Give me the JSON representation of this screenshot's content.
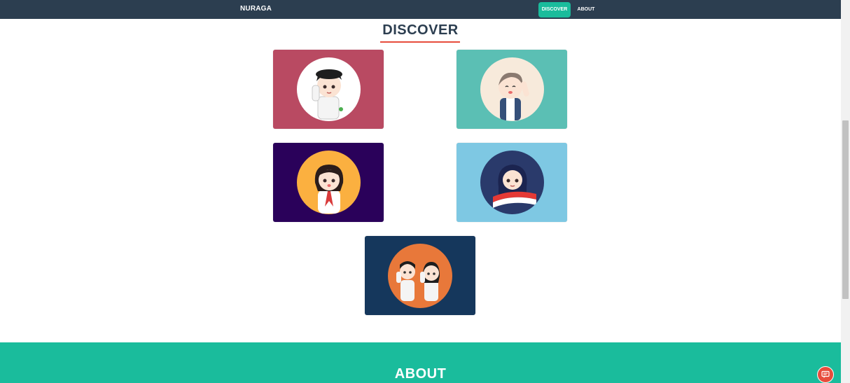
{
  "navbar": {
    "brand": "NURAGA",
    "links": [
      {
        "label": "DISCOVER",
        "active": true
      },
      {
        "label": "ABOUT",
        "active": false
      }
    ]
  },
  "discover": {
    "title": "DISCOVER",
    "cards": [
      {
        "background": "#b94a62",
        "circle": "#ffffff",
        "icon": "scout-boy-salute-avatar"
      },
      {
        "background": "#5bbfb4",
        "circle": "#f7eadb",
        "icon": "boy-waving-avatar"
      },
      {
        "background": "#2a015a",
        "circle": "#fbb040",
        "icon": "scout-girl-avatar"
      },
      {
        "background": "#7ec8e3",
        "circle": "#2a3a6b",
        "icon": "hijab-girl-flag-avatar"
      },
      {
        "background": "#15375c",
        "circle": "#e8783a",
        "icon": "scout-pair-salute-avatar"
      }
    ]
  },
  "about": {
    "title": "ABOUT"
  },
  "colors": {
    "navbar": "#2c3e50",
    "accent": "#1abc9c",
    "underline": "#e74c3c"
  },
  "widgets": {
    "chat_icon": "chat-icon"
  }
}
